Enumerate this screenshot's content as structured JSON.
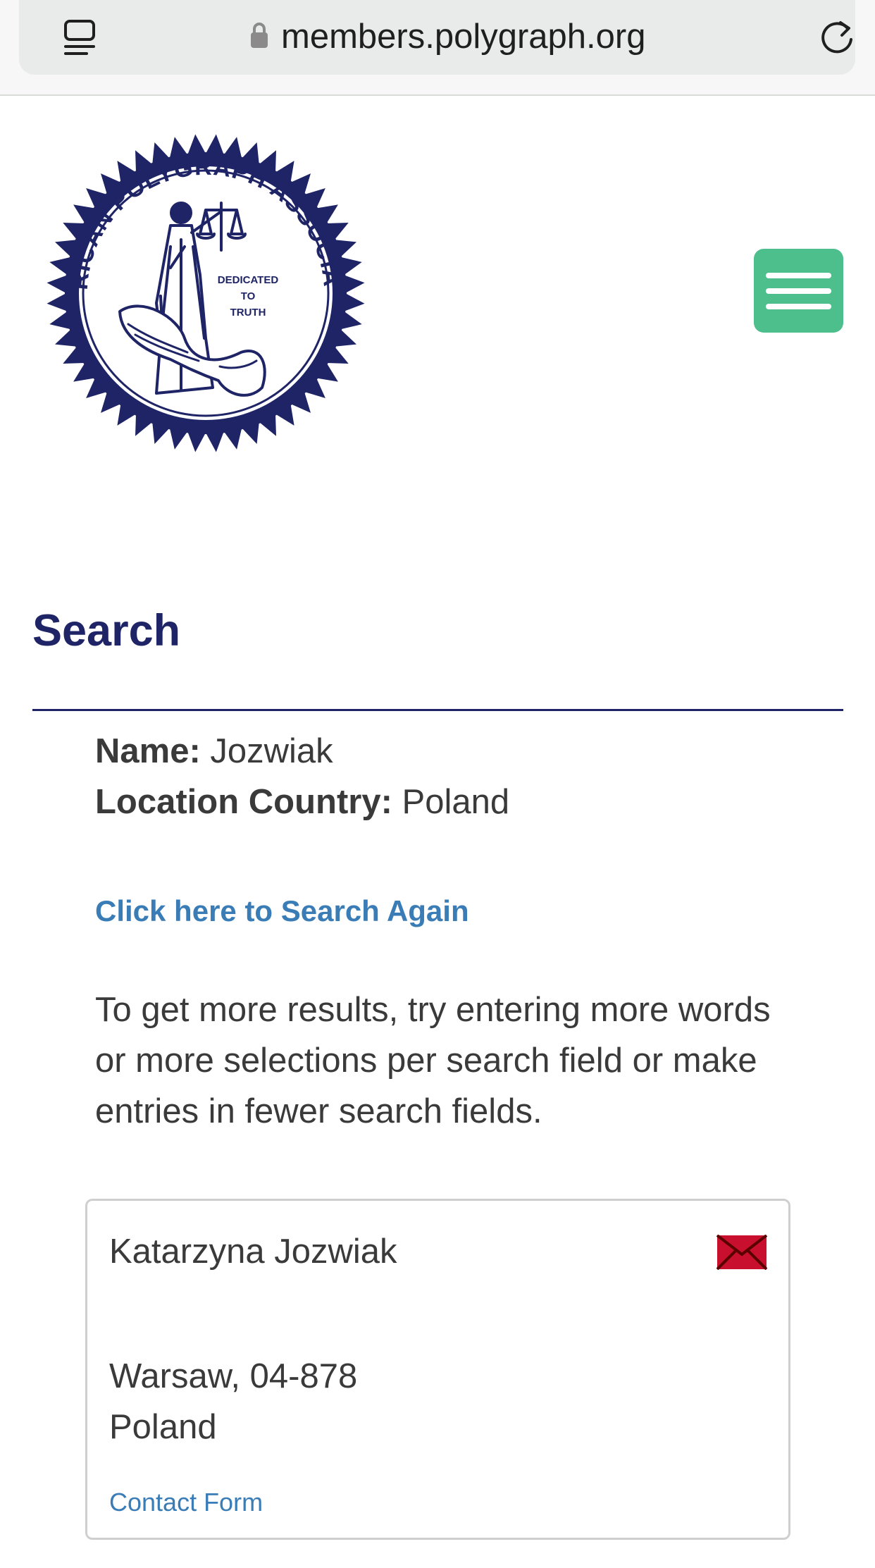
{
  "browser": {
    "url": "members.polygraph.org"
  },
  "logo": {
    "ring_text": "AMERICAN POLYGRAPH ASSOCIATION",
    "motto_line1": "DEDICATED",
    "motto_line2": "TO",
    "motto_line3": "TRUTH",
    "color": "#1e2466"
  },
  "header": {
    "menu_color": "#4cbf8d"
  },
  "page": {
    "title": "Search"
  },
  "criteria": {
    "name_label": "Name:",
    "name_value": "Jozwiak",
    "country_label": "Location Country:",
    "country_value": "Poland"
  },
  "search_again_label": "Click here to Search Again",
  "hint_text": "To get more results, try entering more words or more selections per search field or make entries in fewer search fields.",
  "results": [
    {
      "name": "Katarzyna Jozwiak",
      "city_line": "Warsaw, 04-878",
      "country": "Poland",
      "contact_label": "Contact Form",
      "icon": "envelope-icon"
    }
  ],
  "colors": {
    "title": "#1e2466",
    "link": "#3a7cb6",
    "mail_icon": "#c8102e"
  }
}
